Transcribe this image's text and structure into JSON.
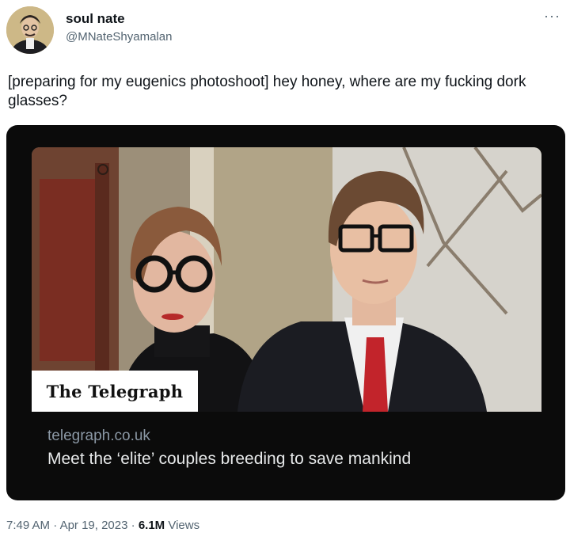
{
  "author": {
    "display_name": "soul nate",
    "handle": "@MNateShyamalan"
  },
  "menu_icon": "more-horizontal-icon",
  "tweet": {
    "text": "[preparing for my eugenics photoshoot] hey honey, where are my fucking dork glasses?"
  },
  "link_card": {
    "image_logo": "The Telegraph",
    "domain": "telegraph.co.uk",
    "headline": "Meet the ‘elite’ couples breeding to save mankind"
  },
  "meta": {
    "time": "7:49 AM",
    "sep1": "·",
    "date": "Apr 19, 2023",
    "sep2": "·",
    "views_count": "6.1M",
    "views_label": "Views"
  },
  "colors": {
    "text_primary": "#0f1419",
    "text_secondary": "#536471",
    "card_background": "#0b0b0b",
    "card_text": "#e7e9ea"
  }
}
